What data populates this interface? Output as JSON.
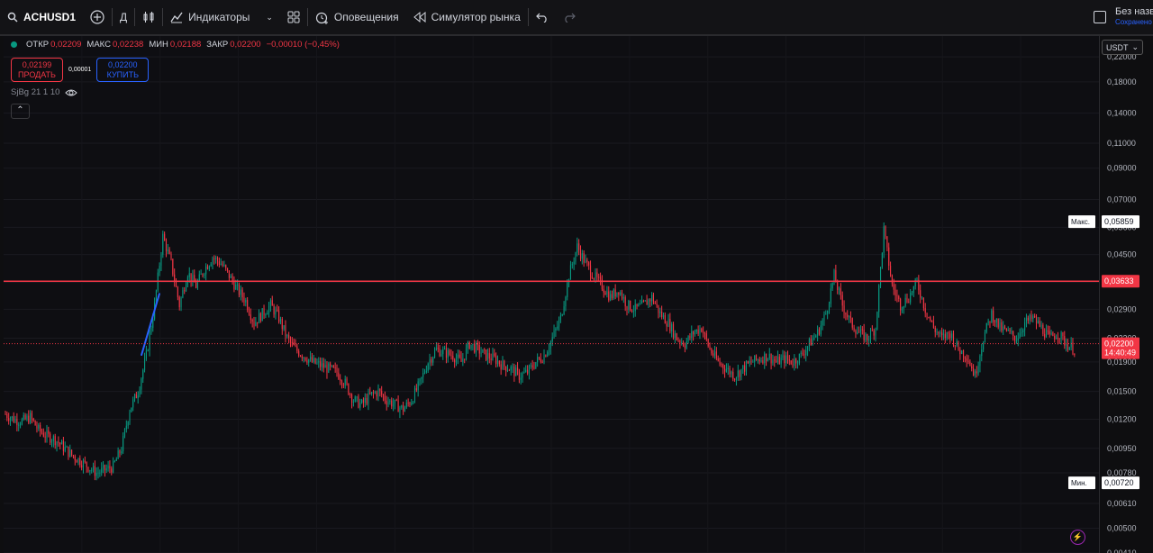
{
  "toolbar": {
    "symbol": "ACHUSD1",
    "interval": "Д",
    "indicators_label": "Индикаторы",
    "alerts_label": "Оповещения",
    "simulator_label": "Симулятор рынка",
    "layout_name": "Без назв",
    "saved_label": "Сохранено"
  },
  "legend": {
    "open_label": "ОТКР",
    "open": "0,02209",
    "high_label": "МАКС",
    "high": "0,02238",
    "low_label": "МИН",
    "low": "0,02188",
    "close_label": "ЗАКР",
    "close": "0,02200",
    "change": "−0,00010 (−0,45%)"
  },
  "trade": {
    "sell_price": "0,02199",
    "sell_label": "ПРОДАТЬ",
    "spread": "0,00001",
    "buy_price": "0,02200",
    "buy_label": "КУПИТЬ"
  },
  "indicator_label": "SjBg 21 1 10",
  "currency": "USDT",
  "colors": {
    "up": "#089981",
    "down": "#f23645",
    "hline": "#f23645",
    "trendline": "#2962ff"
  },
  "chart_data": {
    "type": "candlestick",
    "price_scale": "log",
    "ylim": [
      0.0041,
      0.26
    ],
    "y_ticks": [
      "0,22000",
      "0,18000",
      "0,14000",
      "0,11000",
      "0,09000",
      "0,07000",
      "0,05600",
      "0,04500",
      "0,03600",
      "0,02900",
      "0,02300",
      "0,01900",
      "0,01500",
      "0,01200",
      "0,00950",
      "0,00780",
      "0,00610",
      "0,00500",
      "0,00410"
    ],
    "markers": [
      {
        "label": "Макс.",
        "value": "0,05859",
        "price": 0.05859
      },
      {
        "label": "",
        "value": "0,03633",
        "price": 0.03633
      },
      {
        "label": "",
        "value": "0,02200",
        "time": "14:40:49",
        "price": 0.022
      },
      {
        "label": "Мин.",
        "value": "0,00720",
        "price": 0.0072
      }
    ],
    "horizontal_line": 0.03633,
    "last_price": 0.022,
    "close_path": [
      [
        0,
        0.0125
      ],
      [
        5,
        0.012
      ],
      [
        10,
        0.0118
      ],
      [
        15,
        0.0122
      ],
      [
        20,
        0.011
      ],
      [
        25,
        0.0105
      ],
      [
        30,
        0.0102
      ],
      [
        35,
        0.0096
      ],
      [
        40,
        0.009
      ],
      [
        45,
        0.0086
      ],
      [
        50,
        0.0082
      ],
      [
        55,
        0.0078
      ],
      [
        60,
        0.008
      ],
      [
        65,
        0.0082
      ],
      [
        70,
        0.0095
      ],
      [
        75,
        0.013
      ],
      [
        80,
        0.015
      ],
      [
        85,
        0.02
      ],
      [
        90,
        0.03
      ],
      [
        95,
        0.052
      ],
      [
        100,
        0.042
      ],
      [
        105,
        0.03
      ],
      [
        110,
        0.039
      ],
      [
        115,
        0.035
      ],
      [
        120,
        0.04
      ],
      [
        125,
        0.044
      ],
      [
        130,
        0.042
      ],
      [
        135,
        0.038
      ],
      [
        140,
        0.034
      ],
      [
        145,
        0.031
      ],
      [
        150,
        0.026
      ],
      [
        155,
        0.028
      ],
      [
        160,
        0.03
      ],
      [
        165,
        0.027
      ],
      [
        170,
        0.023
      ],
      [
        175,
        0.021
      ],
      [
        180,
        0.02
      ],
      [
        185,
        0.019
      ],
      [
        190,
        0.0185
      ],
      [
        195,
        0.018
      ],
      [
        200,
        0.0175
      ],
      [
        205,
        0.016
      ],
      [
        210,
        0.014
      ],
      [
        215,
        0.0135
      ],
      [
        220,
        0.0145
      ],
      [
        225,
        0.015
      ],
      [
        230,
        0.014
      ],
      [
        235,
        0.0135
      ],
      [
        240,
        0.013
      ],
      [
        245,
        0.014
      ],
      [
        250,
        0.016
      ],
      [
        255,
        0.019
      ],
      [
        260,
        0.021
      ],
      [
        265,
        0.0205
      ],
      [
        270,
        0.02
      ],
      [
        275,
        0.019
      ],
      [
        280,
        0.022
      ],
      [
        285,
        0.021
      ],
      [
        290,
        0.02
      ],
      [
        295,
        0.0195
      ],
      [
        300,
        0.0185
      ],
      [
        305,
        0.018
      ],
      [
        310,
        0.017
      ],
      [
        315,
        0.0175
      ],
      [
        320,
        0.019
      ],
      [
        325,
        0.02
      ],
      [
        330,
        0.023
      ],
      [
        335,
        0.027
      ],
      [
        340,
        0.038
      ],
      [
        345,
        0.048
      ],
      [
        350,
        0.042
      ],
      [
        355,
        0.038
      ],
      [
        360,
        0.035
      ],
      [
        365,
        0.032
      ],
      [
        370,
        0.034
      ],
      [
        375,
        0.03
      ],
      [
        380,
        0.029
      ],
      [
        385,
        0.03
      ],
      [
        390,
        0.032
      ],
      [
        395,
        0.028
      ],
      [
        400,
        0.026
      ],
      [
        405,
        0.023
      ],
      [
        410,
        0.022
      ],
      [
        415,
        0.024
      ],
      [
        420,
        0.025
      ],
      [
        425,
        0.021
      ],
      [
        430,
        0.019
      ],
      [
        435,
        0.018
      ],
      [
        440,
        0.017
      ],
      [
        445,
        0.018
      ],
      [
        450,
        0.019
      ],
      [
        455,
        0.0195
      ],
      [
        460,
        0.02
      ],
      [
        465,
        0.019
      ],
      [
        470,
        0.0195
      ],
      [
        475,
        0.019
      ],
      [
        480,
        0.02
      ],
      [
        485,
        0.022
      ],
      [
        490,
        0.024
      ],
      [
        495,
        0.028
      ],
      [
        500,
        0.038
      ],
      [
        505,
        0.03
      ],
      [
        510,
        0.026
      ],
      [
        515,
        0.024
      ],
      [
        520,
        0.023
      ],
      [
        525,
        0.025
      ],
      [
        530,
        0.055
      ],
      [
        535,
        0.035
      ],
      [
        540,
        0.03
      ],
      [
        545,
        0.032
      ],
      [
        550,
        0.036
      ],
      [
        555,
        0.029
      ],
      [
        560,
        0.025
      ],
      [
        565,
        0.023
      ],
      [
        570,
        0.024
      ],
      [
        575,
        0.021
      ],
      [
        580,
        0.02
      ],
      [
        585,
        0.017
      ],
      [
        590,
        0.023
      ],
      [
        595,
        0.028
      ],
      [
        600,
        0.025
      ],
      [
        605,
        0.024
      ],
      [
        610,
        0.023
      ],
      [
        615,
        0.026
      ],
      [
        620,
        0.027
      ],
      [
        625,
        0.025
      ],
      [
        630,
        0.023
      ],
      [
        635,
        0.024
      ],
      [
        640,
        0.022
      ],
      [
        645,
        0.021
      ]
    ],
    "trendline": [
      [
        82,
        0.02
      ],
      [
        93,
        0.033
      ]
    ]
  }
}
